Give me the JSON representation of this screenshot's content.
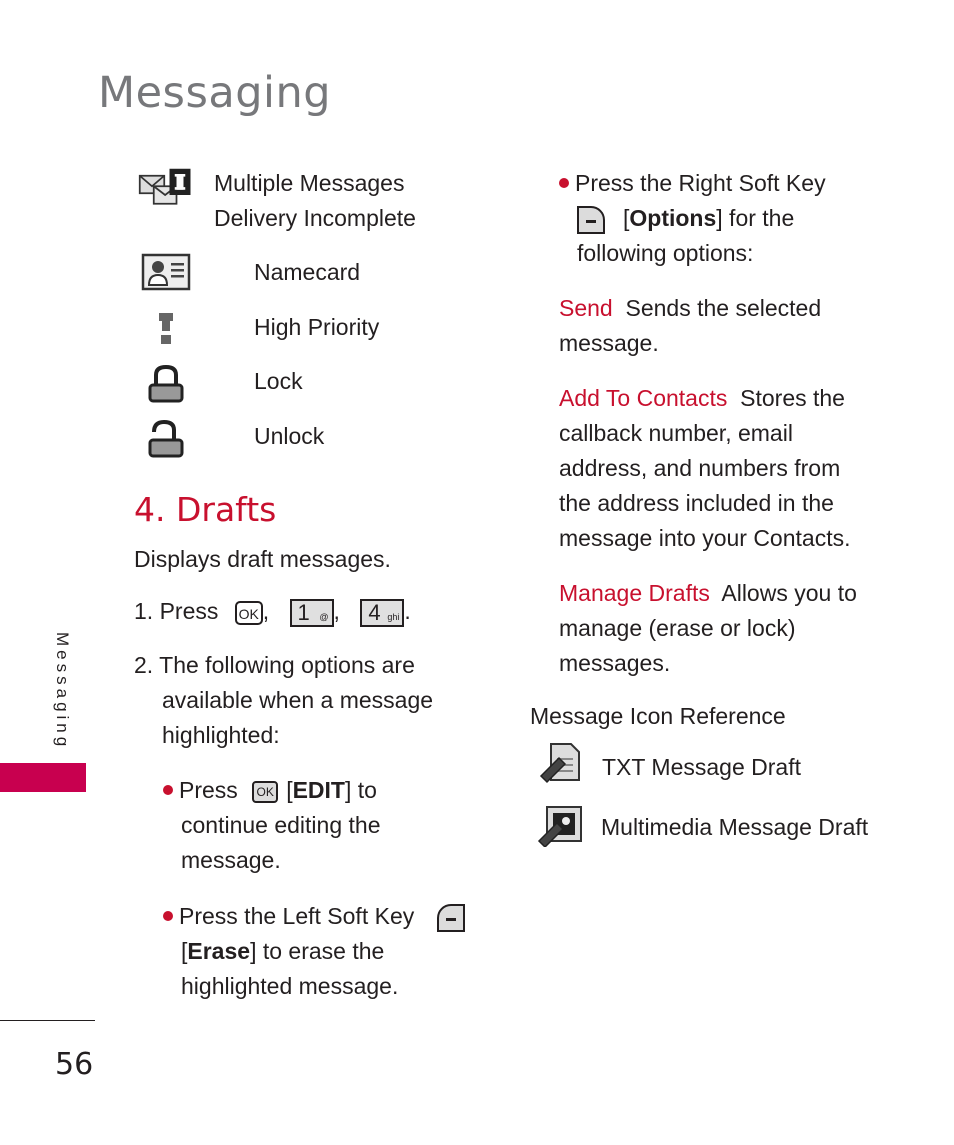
{
  "page": {
    "title": "Messaging",
    "side_label": "Messaging",
    "page_number": "56",
    "accent_color": "#c8102e"
  },
  "icon_list": [
    {
      "icon": "multiple-messages-delivery-incomplete-icon",
      "label_line1": "Multiple Messages",
      "label_line2": "Delivery Incomplete"
    },
    {
      "icon": "namecard-icon",
      "label": "Namecard"
    },
    {
      "icon": "high-priority-icon",
      "label": "High Priority"
    },
    {
      "icon": "lock-icon",
      "label": "Lock"
    },
    {
      "icon": "unlock-icon",
      "label": "Unlock"
    }
  ],
  "drafts": {
    "heading": "4. Drafts",
    "description": "Displays draft messages.",
    "step1": {
      "prefix": "1. Press",
      "keys": [
        {
          "label": "OK"
        },
        {
          "label": "1",
          "sub": "@"
        },
        {
          "label": "4",
          "sub": "ghi"
        }
      ],
      "sep": ",",
      "end": "."
    },
    "step2": {
      "line1": "2. The following options are",
      "line2": "available when a message",
      "line3": "highlighted:"
    },
    "bullets": [
      {
        "pre": "Press",
        "key": "OK",
        "bold": "EDIT",
        "post": " to",
        "line2": "continue editing the",
        "line3": "message."
      },
      {
        "pre": "Press the Left Soft Key",
        "bold": "Erase",
        "post": " to erase the",
        "line3": "highlighted message."
      }
    ]
  },
  "right_col": {
    "bullet": {
      "line1": "Press the Right Soft Key",
      "bold": "Options",
      "post": " for the",
      "line3": "following options:"
    },
    "options": [
      {
        "term": "Send",
        "desc1": "Sends the selected",
        "desc2": "message."
      },
      {
        "term": "Add To Contacts",
        "desc1": "Stores the",
        "desc2": "callback number, email",
        "desc3": "address, and numbers from",
        "desc4": "the address included in the",
        "desc5": "message into your Contacts."
      },
      {
        "term": "Manage Drafts",
        "desc1": "Allows you to",
        "desc2": "manage (erase or lock)",
        "desc3": "messages."
      }
    ],
    "reference_heading": "Message Icon Reference",
    "reference": [
      {
        "icon": "txt-message-draft-icon",
        "label": "TXT Message Draft"
      },
      {
        "icon": "multimedia-message-draft-icon",
        "label": "Multimedia Message Draft"
      }
    ]
  }
}
